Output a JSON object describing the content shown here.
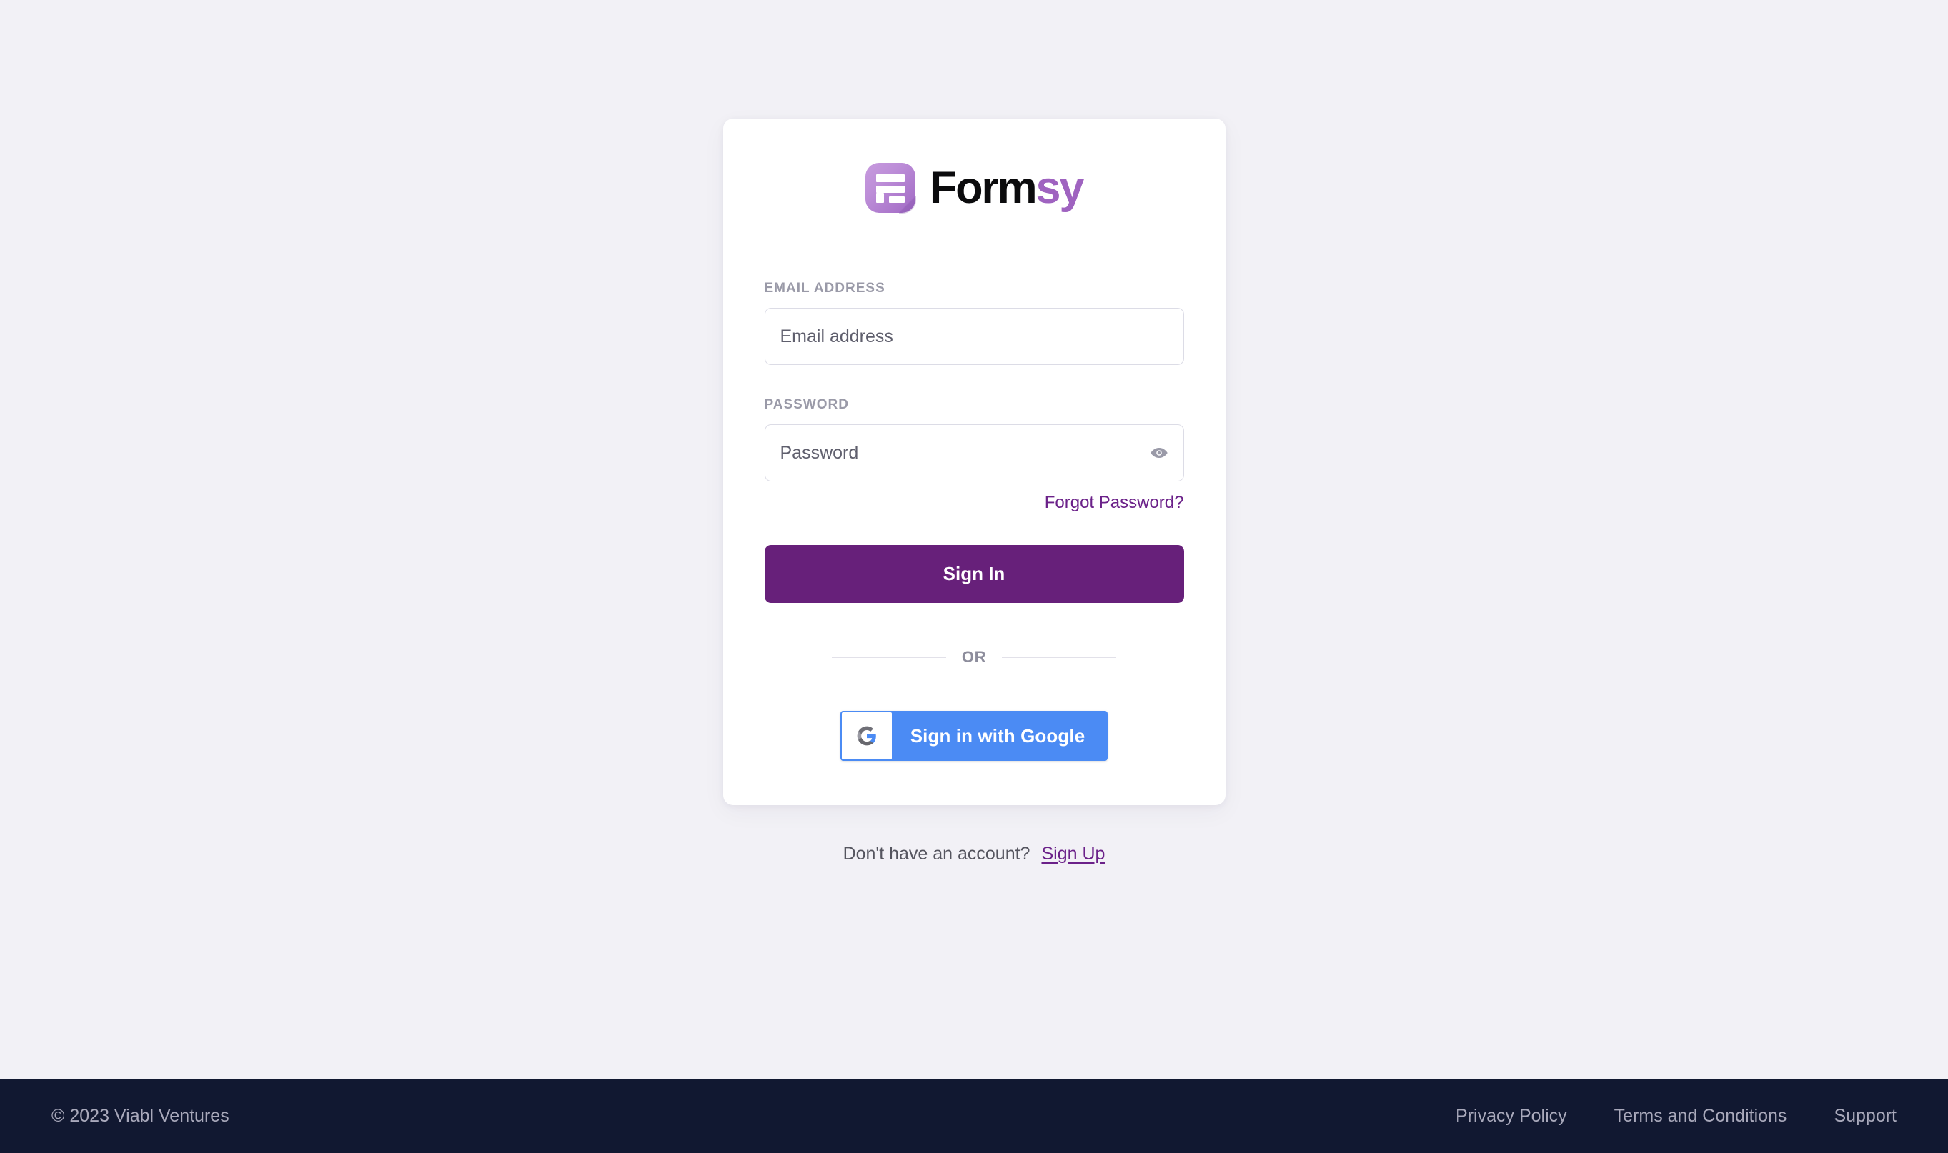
{
  "brand": {
    "mark_icon": "formsy-logo-icon",
    "name_primary": "Form",
    "name_accent": "sy",
    "accent_color": "#9f63c0",
    "mark_gradient_from": "#c79ade",
    "mark_gradient_to": "#a169c4"
  },
  "form": {
    "email": {
      "label": "EMAIL ADDRESS",
      "placeholder": "Email address",
      "value": ""
    },
    "password": {
      "label": "PASSWORD",
      "placeholder": "Password",
      "value": "",
      "toggle_icon": "eye-icon"
    },
    "forgot_password_label": "Forgot Password?",
    "submit_label": "Sign In",
    "submit_color": "#67207a",
    "link_color": "#6b2189"
  },
  "divider": {
    "label": "OR"
  },
  "social": {
    "google": {
      "label": "Sign in with Google",
      "icon": "google-g-icon",
      "button_color": "#4b8bf4"
    }
  },
  "signup": {
    "prompt": "Don't have an account?",
    "link_label": "Sign Up"
  },
  "footer": {
    "copyright": "© 2023 Viabl Ventures",
    "background_color": "#111831",
    "links": [
      {
        "label": "Privacy Policy"
      },
      {
        "label": "Terms and Conditions"
      },
      {
        "label": "Support"
      }
    ]
  },
  "page": {
    "background_color": "#f2f1f6"
  }
}
